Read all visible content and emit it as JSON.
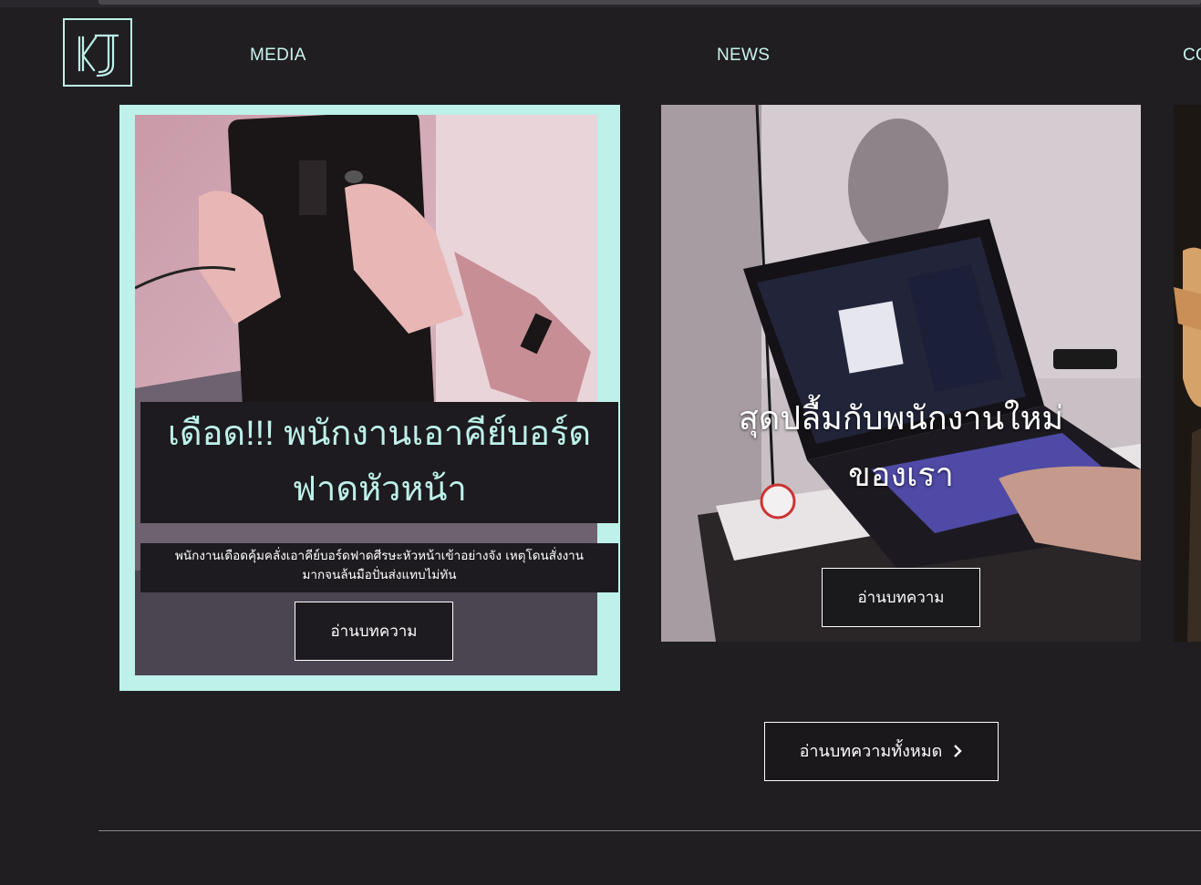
{
  "header": {
    "logo_text": "KJ",
    "nav": [
      "MEDIA",
      "NEWS",
      "CO"
    ]
  },
  "cards": [
    {
      "title_line1": "เดือด!!! พนักงานเอาคีย์บอร์ด",
      "title_line2": "ฟาดหัวหน้า",
      "description_line1": "พนักงานเดือดคุ้มคลั่งเอาคีย์บอร์ดฟาดศีรษะหัวหน้าเข้าอย่างจัง เหตุโดนสั่งงาน",
      "description_line2": "มากจนล้นมือปั่นส่งแทบไม่ทัน",
      "button_label": "อ่านบทความ"
    },
    {
      "title_line1": "สุดปลื้มกับพนักงานใหม่",
      "title_line2": "ของเรา",
      "button_label": "อ่านบทความ"
    }
  ],
  "read_all_label": "อ่านบทความทั้งหมด",
  "read_all_icon": "chevron-right-icon",
  "colors": {
    "accent": "#bdf1ea",
    "background": "#201e21"
  }
}
